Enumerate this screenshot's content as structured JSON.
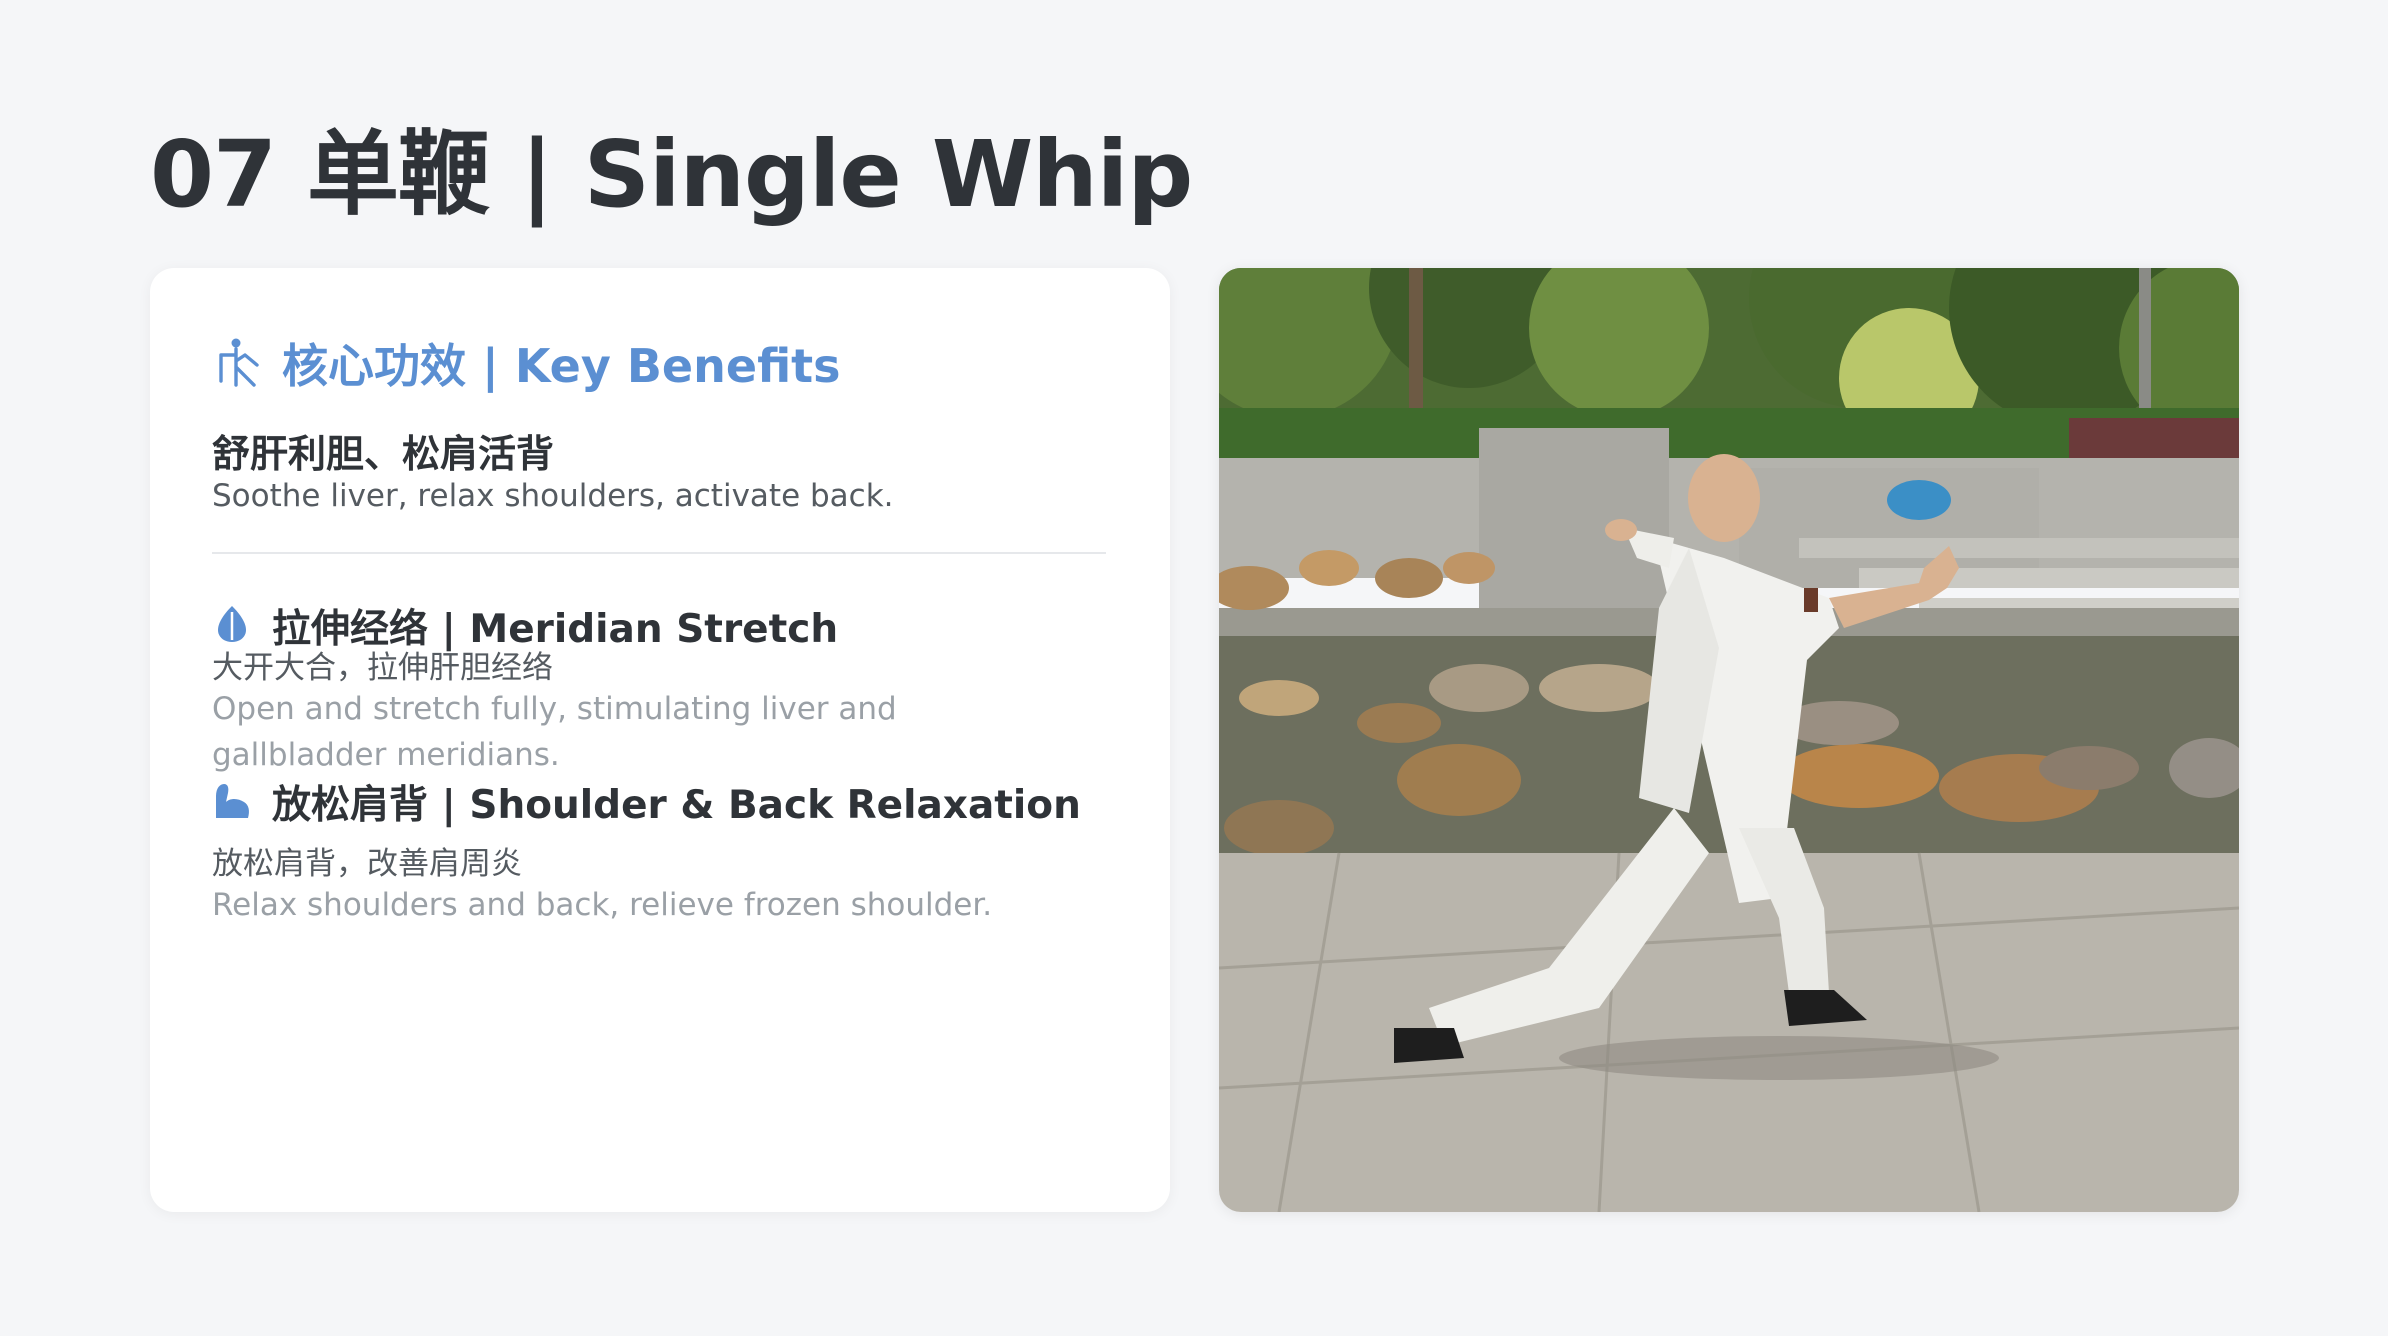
{
  "header": {
    "title": "07 单鞭 | Single Whip"
  },
  "card": {
    "title": "核心功效 | Key Benefits",
    "summary_zh": "舒肝利胆、松肩活背",
    "summary_en": "Soothe liver, relax shoulders, activate back.",
    "benefits": [
      {
        "icon": "leaf-icon",
        "title": "拉伸经络 | Meridian Stretch",
        "zh": "大开大合，拉伸肝胆经络",
        "en": "Open and stretch fully, stimulating liver and gallbladder meridians."
      },
      {
        "icon": "flexed-arm-icon",
        "title": "放松肩背 | Shoulder & Back Relaxation",
        "zh": "放松肩背，改善肩周炎",
        "en": "Relax shoulders and back, relieve frozen shoulder."
      }
    ]
  },
  "colors": {
    "accent": "#5b8fd2",
    "background": "#f5f6f8",
    "card": "#ffffff"
  }
}
